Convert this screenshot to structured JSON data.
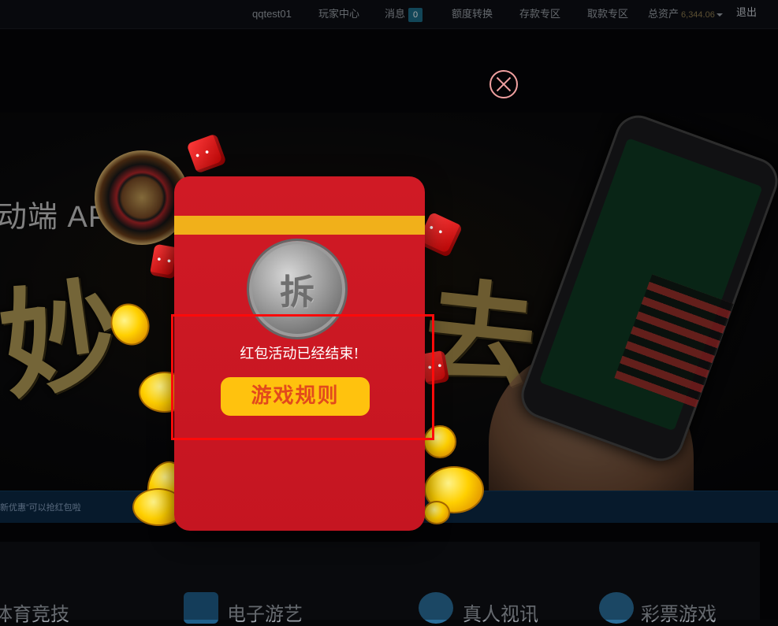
{
  "nav": {
    "username": "qqtest01",
    "player_center": "玩家中心",
    "messages": "消息",
    "messages_count": "0",
    "transfer": "额度转换",
    "deposit": "存款专区",
    "withdraw": "取款专区",
    "total_assets_label": "总资产",
    "total_assets_value": "6,344.06",
    "logout": "退出"
  },
  "banner": {
    "title": "动端 APP一个",
    "calligraphy_left": "妙",
    "calligraphy_right": "去",
    "ticker": "新优惠”可以抢红包啦"
  },
  "categories": [
    {
      "label": "体育竞技"
    },
    {
      "label": "电子游艺"
    },
    {
      "label": "真人视讯"
    },
    {
      "label": "彩票游戏"
    }
  ],
  "modal": {
    "open_char": "拆",
    "ended_text": "红包活动已经结束!",
    "rules_button": "游戏规则"
  }
}
